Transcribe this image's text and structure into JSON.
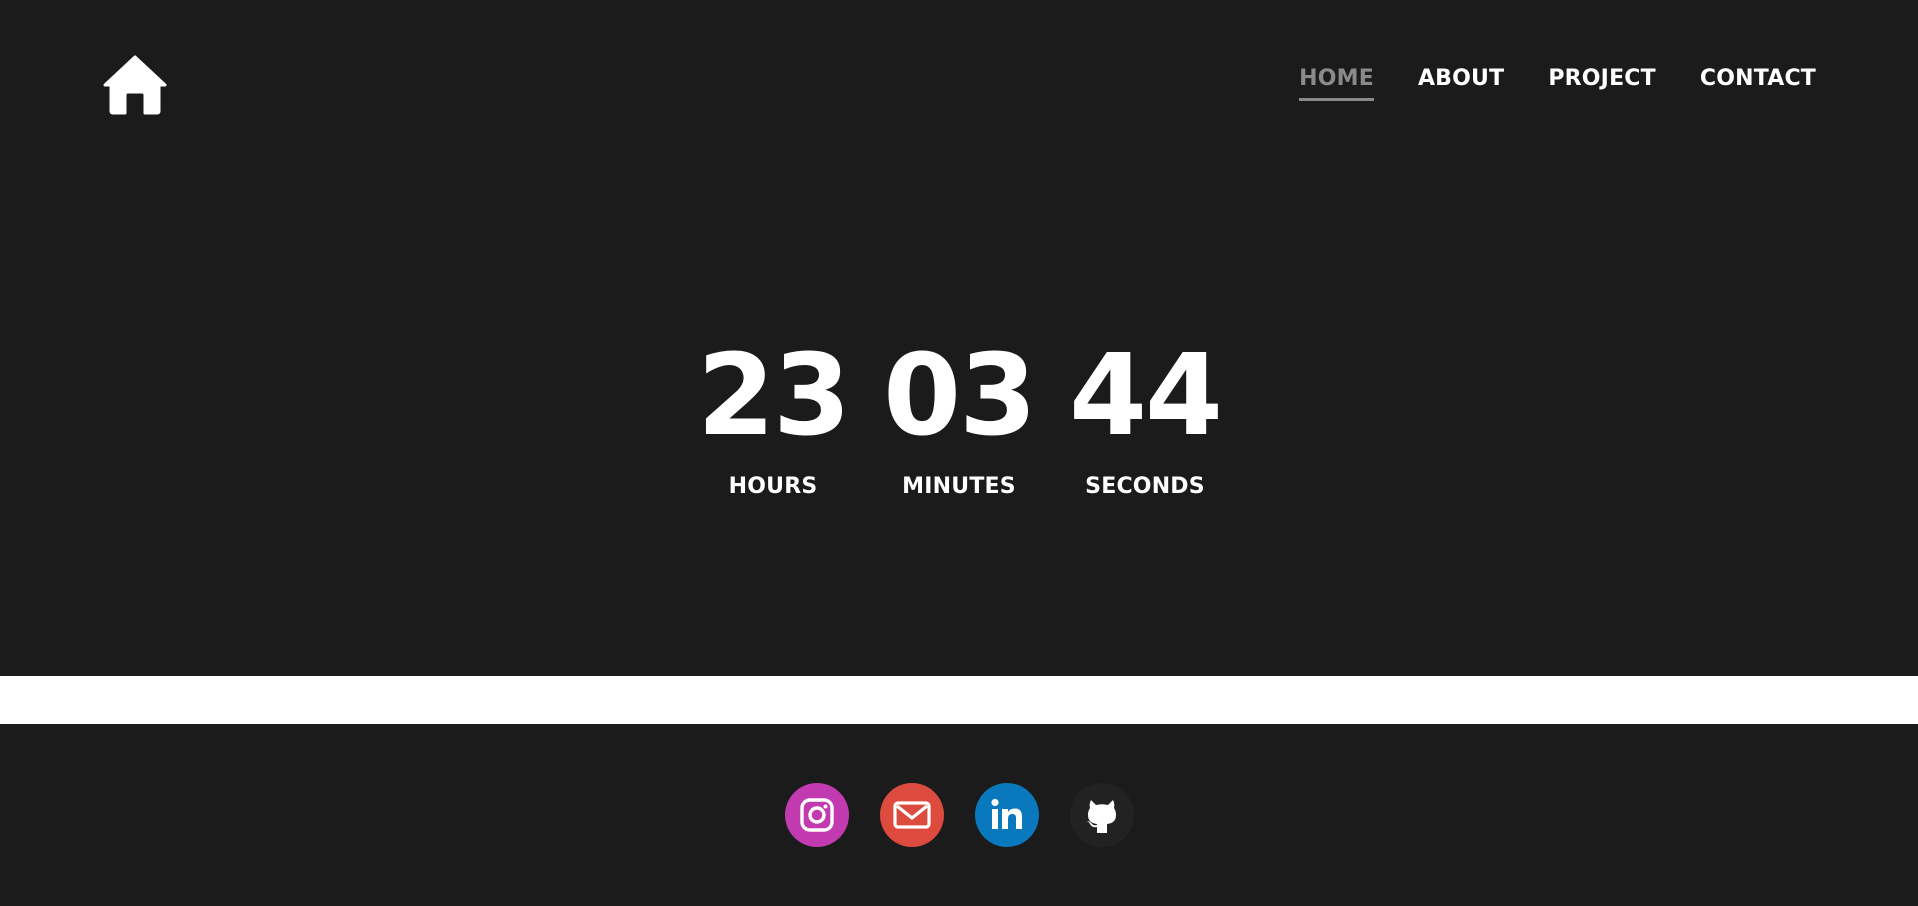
{
  "nav": {
    "logo_icon": "home-icon",
    "items": [
      {
        "label": "HOME",
        "active": true
      },
      {
        "label": "ABOUT",
        "active": false
      },
      {
        "label": "PROJECT",
        "active": false
      },
      {
        "label": "CONTACT",
        "active": false
      }
    ],
    "active_color": "#8a8a8a",
    "text_color": "#ffffff"
  },
  "countdown": {
    "hours": {
      "value": "23",
      "label": "HOURS"
    },
    "minutes": {
      "value": "03",
      "label": "MINUTES"
    },
    "seconds": {
      "value": "44",
      "label": "SECONDS"
    }
  },
  "footer": {
    "socials": [
      {
        "name": "instagram",
        "icon": "instagram-icon",
        "color": "#c13ab0"
      },
      {
        "name": "email",
        "icon": "mail-icon",
        "color": "#dd4b3e"
      },
      {
        "name": "linkedin",
        "icon": "linkedin-icon",
        "color": "#0a78bd"
      },
      {
        "name": "github",
        "icon": "github-icon",
        "color": "#222222"
      }
    ]
  },
  "colors": {
    "background": "#1b1b1b",
    "band": "#ffffff"
  }
}
